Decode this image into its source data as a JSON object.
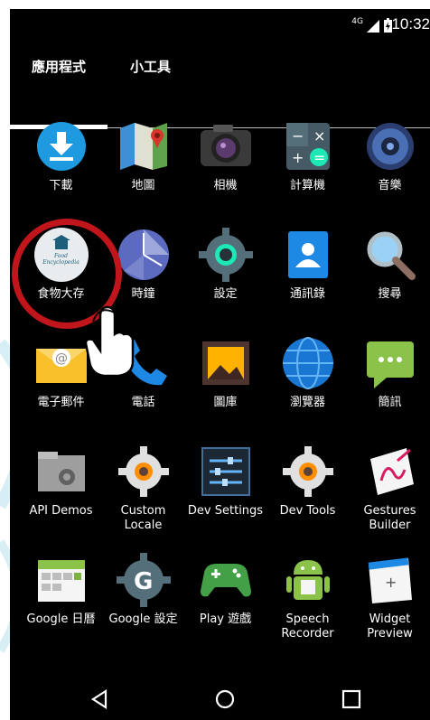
{
  "status": {
    "time": "10:32",
    "network": "4G"
  },
  "tabs": [
    {
      "label": "應用程式"
    },
    {
      "label": "小工具"
    }
  ],
  "apps": [
    {
      "label": "下載",
      "icon": "download-icon"
    },
    {
      "label": "地圖",
      "icon": "maps-icon"
    },
    {
      "label": "相機",
      "icon": "camera-icon"
    },
    {
      "label": "計算機",
      "icon": "calculator-icon"
    },
    {
      "label": "音樂",
      "icon": "music-icon"
    },
    {
      "label": "食物大存",
      "icon": "food-encyclopedia-icon",
      "logo_text": "Food Encyclopedia"
    },
    {
      "label": "時鐘",
      "icon": "clock-icon"
    },
    {
      "label": "設定",
      "icon": "settings-icon"
    },
    {
      "label": "通訊錄",
      "icon": "contacts-icon"
    },
    {
      "label": "搜尋",
      "icon": "search-icon"
    },
    {
      "label": "電子郵件",
      "icon": "email-icon"
    },
    {
      "label": "電話",
      "icon": "phone-icon"
    },
    {
      "label": "圖庫",
      "icon": "gallery-icon"
    },
    {
      "label": "瀏覽器",
      "icon": "browser-icon"
    },
    {
      "label": "簡訊",
      "icon": "messaging-icon"
    },
    {
      "label": "API Demos",
      "icon": "api-demos-icon"
    },
    {
      "label": "Custom Locale",
      "icon": "custom-locale-icon"
    },
    {
      "label": "Dev Settings",
      "icon": "dev-settings-icon"
    },
    {
      "label": "Dev Tools",
      "icon": "dev-tools-icon"
    },
    {
      "label": "Gestures Builder",
      "icon": "gestures-builder-icon"
    },
    {
      "label": "Google 日曆",
      "icon": "google-calendar-icon"
    },
    {
      "label": "Google 設定",
      "icon": "google-settings-icon"
    },
    {
      "label": "Play 遊戲",
      "icon": "play-games-icon"
    },
    {
      "label": "Speech Recorder",
      "icon": "speech-recorder-icon"
    },
    {
      "label": "Widget Preview",
      "icon": "widget-preview-icon"
    }
  ],
  "colors": {
    "highlight": "#c0161b",
    "background": "#000000"
  }
}
